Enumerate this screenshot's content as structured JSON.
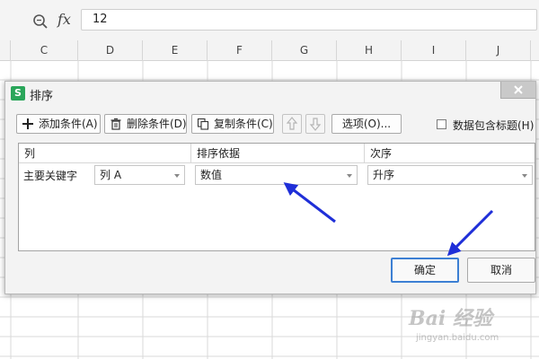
{
  "formula_bar": {
    "fx": "fx",
    "value": "12"
  },
  "columns": [
    "C",
    "D",
    "E",
    "F",
    "G",
    "H",
    "I",
    "J"
  ],
  "dialog": {
    "title": "排序",
    "app_icon": "S",
    "toolbar": {
      "add": "添加条件(A)",
      "delete": "删除条件(D)",
      "copy": "复制条件(C)",
      "options": "选项(O)...",
      "has_header_label": "数据包含标题(H)",
      "has_header_checked": false
    },
    "table": {
      "headers": [
        "列",
        "排序依据",
        "次序"
      ],
      "rows": [
        {
          "label": "主要关键字",
          "column": "列 A",
          "sort_on": "数值",
          "order": "升序"
        }
      ]
    },
    "ok": "确定",
    "cancel": "取消"
  },
  "watermark": {
    "text": "Bai 经验",
    "sub": "jingyan.baidu.com"
  },
  "colors": {
    "ok_border": "#3c7fd3",
    "annotation_arrow": "#1f2fd8",
    "app_icon": "#2aa65a"
  }
}
